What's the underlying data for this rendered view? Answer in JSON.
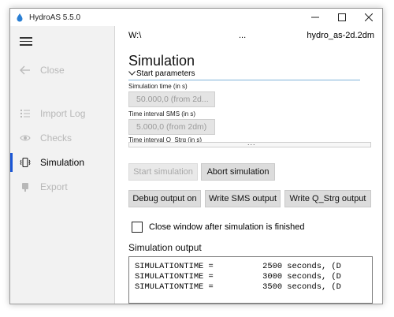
{
  "window": {
    "title": "HydroAS 5.5.0"
  },
  "sidebar": {
    "items": [
      {
        "label": "Close",
        "icon": "back-arrow-icon",
        "state": "disabled"
      },
      {
        "label": "Import Log",
        "icon": "list-icon",
        "state": "disabled"
      },
      {
        "label": "Checks",
        "icon": "eye-icon",
        "state": "disabled"
      },
      {
        "label": "Simulation",
        "icon": "phone-vibrate-icon",
        "state": "active"
      },
      {
        "label": "Export",
        "icon": "export-icon",
        "state": "disabled"
      }
    ],
    "accent_color": "#1a56d6"
  },
  "pathbar": {
    "left": "W:\\",
    "middle": "...",
    "right": "hydro_as-2d.2dm"
  },
  "main": {
    "heading": "Simulation",
    "expander_label": "Start parameters",
    "fields": [
      {
        "label": "Simulation time (in s)",
        "value": "50.000,0 (from 2d..."
      },
      {
        "label": "Time interval SMS (in s)",
        "value": "5.000,0 (from 2dm)"
      },
      {
        "label": "Time interval Q_Strg (in s)",
        "value": ""
      }
    ],
    "scroll_indicator": "...",
    "buttons": {
      "start": "Start simulation",
      "abort": "Abort simulation",
      "debug": "Debug output on",
      "write_sms": "Write SMS output",
      "write_qstrg": "Write Q_Strg output"
    },
    "close_checkbox_label": "Close window after simulation is finished",
    "close_checkbox_checked": false,
    "output_title": "Simulation output",
    "output_lines": [
      "SIMULATIONTIME =          2500 seconds, (D",
      "SIMULATIONTIME =          3000 seconds, (D",
      "SIMULATIONTIME =          3500 seconds, (D"
    ]
  }
}
